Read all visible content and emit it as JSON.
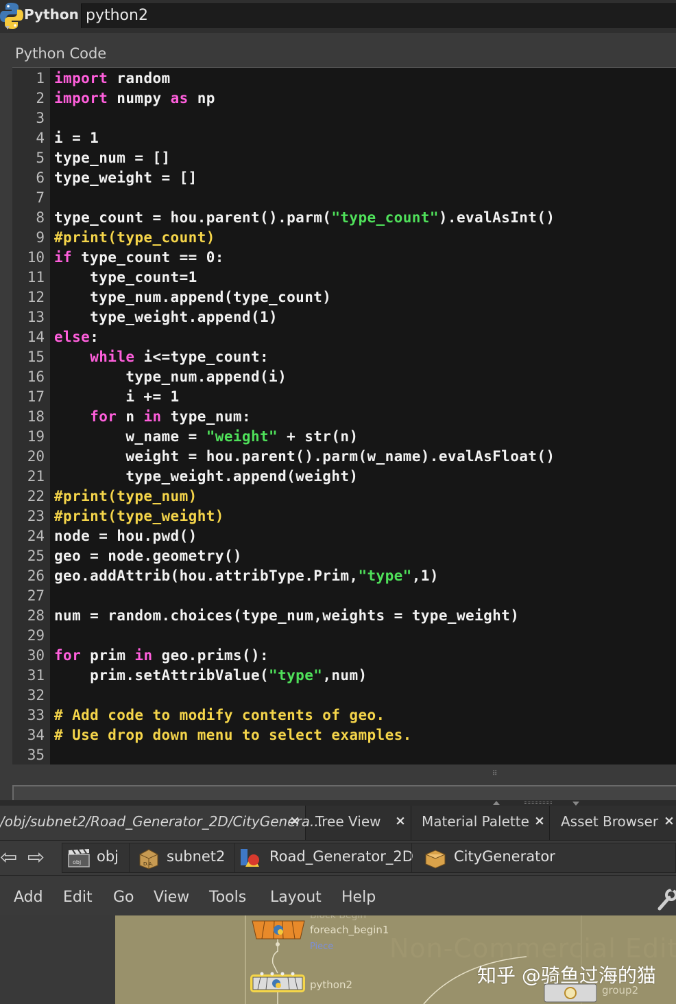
{
  "header": {
    "node_type": "Python",
    "node_name": "python2"
  },
  "parm_label": "Python Code",
  "code_lines": [
    {
      "n": "1",
      "segs": [
        [
          "kw",
          "import"
        ],
        [
          "t",
          " random"
        ]
      ]
    },
    {
      "n": "2",
      "segs": [
        [
          "kw",
          "import"
        ],
        [
          "t",
          " numpy "
        ],
        [
          "kw",
          "as"
        ],
        [
          "t",
          " np"
        ]
      ]
    },
    {
      "n": "3",
      "segs": []
    },
    {
      "n": "4",
      "segs": [
        [
          "t",
          "i = 1"
        ]
      ]
    },
    {
      "n": "5",
      "segs": [
        [
          "t",
          "type_num = []"
        ]
      ]
    },
    {
      "n": "6",
      "segs": [
        [
          "t",
          "type_weight = []"
        ]
      ]
    },
    {
      "n": "7",
      "segs": []
    },
    {
      "n": "8",
      "segs": [
        [
          "t",
          "type_count = hou.parent().parm("
        ],
        [
          "str",
          "\"type_count\""
        ],
        [
          "t",
          ").evalAsInt()"
        ]
      ]
    },
    {
      "n": "9",
      "segs": [
        [
          "cm",
          "#print(type_count)"
        ]
      ]
    },
    {
      "n": "10",
      "segs": [
        [
          "kw",
          "if"
        ],
        [
          "t",
          " type_count == 0:"
        ]
      ]
    },
    {
      "n": "11",
      "segs": [
        [
          "t",
          "    type_count=1"
        ]
      ]
    },
    {
      "n": "12",
      "segs": [
        [
          "t",
          "    type_num.append(type_count)"
        ]
      ]
    },
    {
      "n": "13",
      "segs": [
        [
          "t",
          "    type_weight.append(1)"
        ]
      ]
    },
    {
      "n": "14",
      "segs": [
        [
          "kw",
          "else"
        ],
        [
          "t",
          ":"
        ]
      ]
    },
    {
      "n": "15",
      "segs": [
        [
          "t",
          "    "
        ],
        [
          "kw",
          "while"
        ],
        [
          "t",
          " i<=type_count:"
        ]
      ]
    },
    {
      "n": "16",
      "segs": [
        [
          "t",
          "        type_num.append(i)"
        ]
      ]
    },
    {
      "n": "17",
      "segs": [
        [
          "t",
          "        i += 1"
        ]
      ]
    },
    {
      "n": "18",
      "segs": [
        [
          "t",
          "    "
        ],
        [
          "kw",
          "for"
        ],
        [
          "t",
          " n "
        ],
        [
          "kw",
          "in"
        ],
        [
          "t",
          " type_num:"
        ]
      ]
    },
    {
      "n": "19",
      "segs": [
        [
          "t",
          "        w_name = "
        ],
        [
          "str",
          "\"weight\""
        ],
        [
          "t",
          " + str(n)"
        ]
      ]
    },
    {
      "n": "20",
      "segs": [
        [
          "t",
          "        weight = hou.parent().parm(w_name).evalAsFloat()"
        ]
      ]
    },
    {
      "n": "21",
      "segs": [
        [
          "t",
          "        type_weight.append(weight)"
        ]
      ]
    },
    {
      "n": "22",
      "segs": [
        [
          "cm",
          "#print(type_num)"
        ]
      ]
    },
    {
      "n": "23",
      "segs": [
        [
          "cm",
          "#print(type_weight)"
        ]
      ]
    },
    {
      "n": "24",
      "segs": [
        [
          "t",
          "node = hou.pwd()"
        ]
      ]
    },
    {
      "n": "25",
      "segs": [
        [
          "t",
          "geo = node.geometry()"
        ]
      ]
    },
    {
      "n": "26",
      "segs": [
        [
          "t",
          "geo.addAttrib(hou.attribType.Prim,"
        ],
        [
          "str",
          "\"type\""
        ],
        [
          "t",
          ",1)"
        ]
      ]
    },
    {
      "n": "27",
      "segs": []
    },
    {
      "n": "28",
      "segs": [
        [
          "t",
          "num = random.choices(type_num,weights = type_weight)"
        ]
      ]
    },
    {
      "n": "29",
      "segs": []
    },
    {
      "n": "30",
      "segs": [
        [
          "kw",
          "for"
        ],
        [
          "t",
          " prim "
        ],
        [
          "kw",
          "in"
        ],
        [
          "t",
          " geo.prims():"
        ]
      ]
    },
    {
      "n": "31",
      "segs": [
        [
          "t",
          "    prim.setAttribValue("
        ],
        [
          "str",
          "\"type\""
        ],
        [
          "t",
          ",num)"
        ]
      ]
    },
    {
      "n": "32",
      "segs": []
    },
    {
      "n": "33",
      "segs": [
        [
          "cm",
          "# Add code to modify contents of geo."
        ]
      ]
    },
    {
      "n": "34",
      "segs": [
        [
          "cm",
          "# Use drop down menu to select examples."
        ]
      ]
    },
    {
      "n": "35",
      "segs": []
    }
  ],
  "tabs": {
    "path": "/obj/subnet2/Road_Generator_2D/CityGenera...",
    "tree_view": "Tree View",
    "material_palette": "Material Palette",
    "asset_browser": "Asset Browser",
    "close_glyph": "×"
  },
  "breadcrumbs": {
    "obj": "obj",
    "subnet": "subnet2",
    "road": "Road_Generator_2D",
    "city": "CityGenerator"
  },
  "menu": {
    "add": "Add",
    "edit": "Edit",
    "go": "Go",
    "view": "View",
    "tools": "Tools",
    "layout": "Layout",
    "help": "Help"
  },
  "network": {
    "block_begin_label": "Block Begin",
    "foreach_node": "foreach_begin1",
    "piece_label": "Piece",
    "python_node": "python2",
    "group_node": "group2",
    "edition_watermark": "Non-Commercial Edition",
    "site_watermark": "知乎 @骑鱼过海的猫"
  },
  "colors": {
    "keyword": "#ff5fdc",
    "string": "#4fe05a",
    "comment": "#f5d54a",
    "code_bg": "#161616",
    "network_bg": "#99916b"
  }
}
